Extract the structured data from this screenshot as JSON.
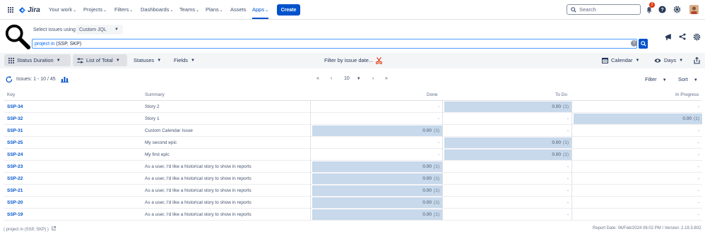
{
  "nav": {
    "brand": "Jira",
    "items": [
      {
        "label": "Your work",
        "chev": "⌄"
      },
      {
        "label": "Projects",
        "chev": "⌄"
      },
      {
        "label": "Filters",
        "chev": "⌄"
      },
      {
        "label": "Dashboards",
        "chev": "⌄"
      },
      {
        "label": "Teams",
        "chev": "⌄"
      },
      {
        "label": "Plans",
        "chev": "⌄"
      },
      {
        "label": "Assets",
        "chev": ""
      },
      {
        "label": "Apps",
        "chev": "⌄"
      }
    ],
    "create_label": "Create",
    "search_placeholder": "Search",
    "notification_count": "2"
  },
  "query": {
    "select_label": "Select issues using",
    "select_value": "Custom JQL",
    "jql_keyword": "project in",
    "jql_rest": "(SSP, SKP)",
    "help": "?"
  },
  "toolbar": {
    "status_duration": "Status Duration",
    "list_of_total": "List of Total",
    "statuses": "Statuses",
    "fields": "Fields",
    "filter_by_date": "Filter by issue date...",
    "calendar": "Calendar",
    "days": "Days"
  },
  "pager": {
    "issues_label": "Issues: 1 - 10 / 45",
    "first": "«",
    "prev": "‹",
    "page_size": "10",
    "next": "›",
    "last": "»",
    "filter": "Filter",
    "sort": "Sort"
  },
  "table": {
    "headers": {
      "key": "Key",
      "summary": "Summary",
      "done": "Done",
      "todo": "To Do",
      "inprogress": "In Progress"
    },
    "rows": [
      {
        "key": "SSP-34",
        "summary": "Story 2",
        "done": "-",
        "todo": "0.00",
        "todo_n": "(1)",
        "ip": "-"
      },
      {
        "key": "SSP-32",
        "summary": "Story 1",
        "done": "-",
        "todo": "-",
        "ip": "0.00",
        "ip_n": "(1)"
      },
      {
        "key": "SSP-31",
        "summary": "Custom Calendar Issue",
        "done": "0.00",
        "done_n": "(1)",
        "todo": "-",
        "ip": "-"
      },
      {
        "key": "SSP-25",
        "summary": "My second epic",
        "done": "-",
        "todo": "0.00",
        "todo_n": "(1)",
        "ip": "-"
      },
      {
        "key": "SSP-24",
        "summary": "My first epic",
        "done": "-",
        "todo": "0.00",
        "todo_n": "(1)",
        "ip": "-"
      },
      {
        "key": "SSP-23",
        "summary": "As a user, I'd like a historical story to show in reports",
        "done": "0.00",
        "done_n": "(1)",
        "todo": "-",
        "ip": "-"
      },
      {
        "key": "SSP-22",
        "summary": "As a user, I'd like a historical story to show in reports",
        "done": "0.00",
        "done_n": "(1)",
        "todo": "-",
        "ip": "-"
      },
      {
        "key": "SSP-21",
        "summary": "As a user, I'd like a historical story to show in reports",
        "done": "0.00",
        "done_n": "(1)",
        "todo": "-",
        "ip": "-"
      },
      {
        "key": "SSP-20",
        "summary": "As a user, I'd like a historical story to show in reports",
        "done": "0.00",
        "done_n": "(1)",
        "todo": "-",
        "ip": "-"
      },
      {
        "key": "SSP-19",
        "summary": "As a user, I'd like a historical story to show in reports",
        "done": "0.00",
        "done_n": "(1)",
        "todo": "-",
        "ip": "-"
      }
    ]
  },
  "footer": {
    "query_text": "( project in (SSP, SKP) )",
    "report_info": "Report Date: 06/Feb/2024 06:02 PM / Version: 2.19.3.802"
  },
  "colors": {
    "accent": "#0052cc",
    "bar": "#c7d9eb",
    "danger": "#de350b"
  }
}
